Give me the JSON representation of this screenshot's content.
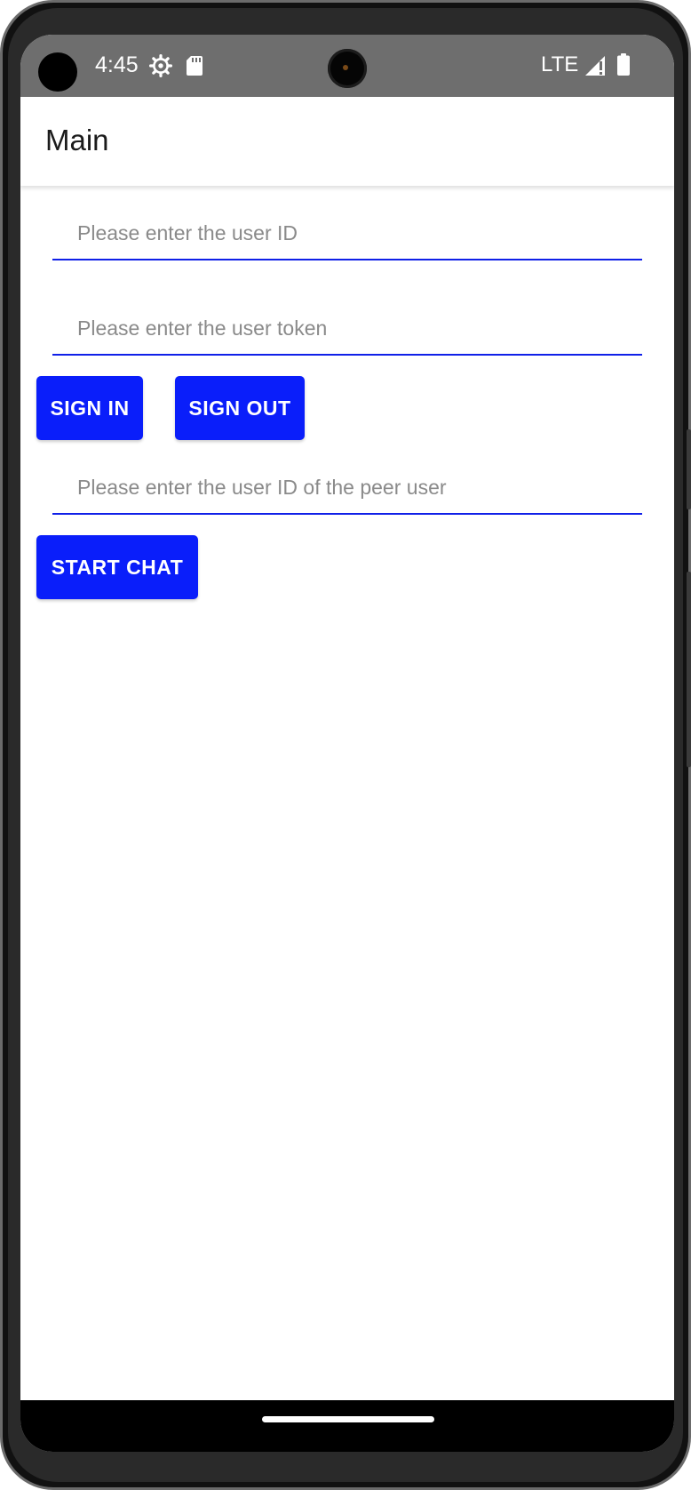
{
  "status_bar": {
    "time": "4:45",
    "network": "LTE",
    "icons": [
      "gear-icon",
      "sd-card-icon",
      "signal-icon",
      "battery-icon"
    ]
  },
  "app_bar": {
    "title": "Main"
  },
  "form": {
    "user_id": {
      "value": "",
      "placeholder": "Please enter the user ID"
    },
    "user_token": {
      "value": "",
      "placeholder": "Please enter the user token"
    },
    "sign_in_label": "SIGN IN",
    "sign_out_label": "SIGN OUT",
    "peer_user_id": {
      "value": "",
      "placeholder": "Please enter the user ID of the peer user"
    },
    "start_chat_label": "START CHAT"
  },
  "colors": {
    "accent": "#0a1efa",
    "underline": "#1020e8",
    "status_bar": "#6e6e6e",
    "placeholder": "#8a8a8a"
  }
}
